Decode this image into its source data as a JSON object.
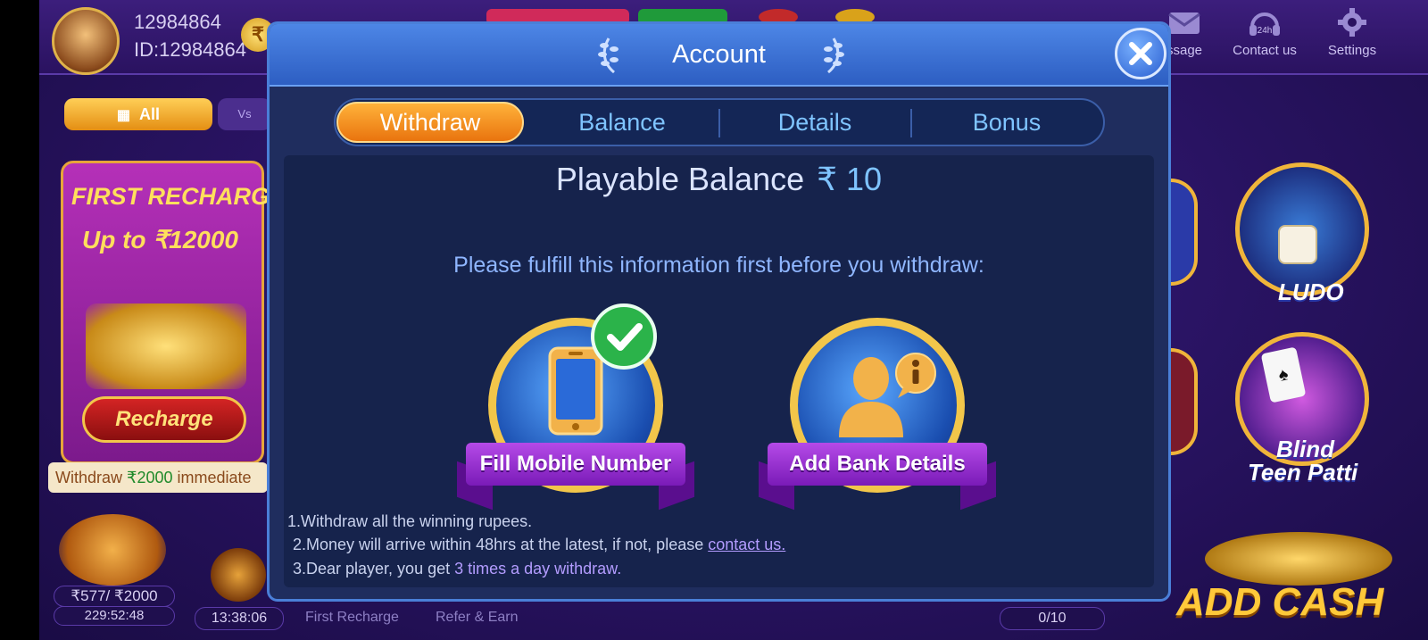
{
  "background": {
    "user": {
      "name": "12984864",
      "id_label": "ID:12984864"
    },
    "coin_symbol": "₹",
    "top_right": [
      {
        "icon": "message-icon",
        "label": "ssage"
      },
      {
        "icon": "headset-icon",
        "badge": "24h",
        "label": "Contact us"
      },
      {
        "icon": "gear-icon",
        "label": "Settings"
      }
    ],
    "filters": {
      "all": "All",
      "vs": "Vs"
    },
    "promo": {
      "title": "FIRST RECHARGE",
      "subtitle": "Up to ₹12000",
      "button": "Recharge"
    },
    "withdraw_strip": {
      "prefix": "Withdraw ",
      "amount": "₹2000",
      "suffix": " immediate"
    },
    "bottom": {
      "reward": "₹577/ ₹2000",
      "timer1": "229:52:48",
      "timer2": "13:38:06",
      "first_recharge": "First Recharge",
      "refer": "Refer & Earn",
      "counter": "0/10"
    },
    "games": {
      "ludo": "LUDO",
      "blind_line1": "Blind",
      "blind_line2": "Teen Patti"
    },
    "add_cash": "ADD CASH"
  },
  "modal": {
    "title": "Account",
    "tabs": [
      {
        "label": "Withdraw",
        "active": true
      },
      {
        "label": "Balance",
        "active": false
      },
      {
        "label": "Details",
        "active": false
      },
      {
        "label": "Bonus",
        "active": false
      }
    ],
    "playable_balance": {
      "label": "Playable Balance",
      "amount": "₹ 10"
    },
    "info": "Please fulfill this information first before you withdraw:",
    "actions": {
      "mobile": {
        "label": "Fill Mobile Number",
        "icon": "phone-icon",
        "completed": true
      },
      "bank": {
        "label": "Add Bank Details",
        "icon": "user-info-icon",
        "completed": false
      }
    },
    "rules": {
      "r1": "1.Withdraw all the winning rupees.",
      "r2_text": "2.Money will arrive within 48hrs at the latest, if not, please ",
      "r2_link": "contact us.",
      "r3_text": "3.Dear player, you get ",
      "r3_highlight": "3 times a day withdraw."
    }
  },
  "colors": {
    "accent_orange": "#e9740e",
    "tab_text": "#7fc4ff",
    "modal_bg": "#1f2d5e",
    "link": "#b39cff",
    "success": "#2bb34a"
  }
}
